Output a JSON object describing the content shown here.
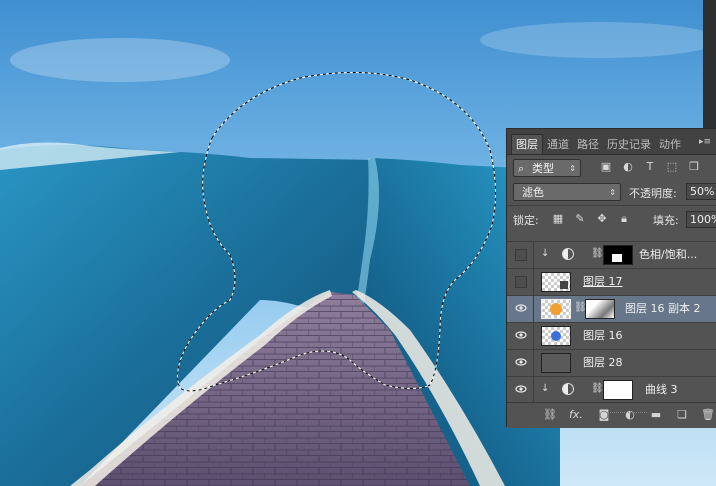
{
  "panel": {
    "tabs": [
      "图层",
      "通道",
      "路径",
      "历史记录",
      "动作"
    ],
    "active_tab": "图层",
    "filter": {
      "label": "类型"
    },
    "blend_mode": "滤色",
    "opacity_label": "不透明度:",
    "opacity_value": "50%",
    "lock_label": "锁定:",
    "fill_label": "填充:",
    "fill_value": "100%",
    "layers": [
      {
        "name": "色相/饱和...",
        "visible": false,
        "type": "adjustment"
      },
      {
        "name": "图层 17",
        "visible": false,
        "type": "pixel"
      },
      {
        "name": "图层 16 副本 2",
        "visible": true,
        "type": "masked",
        "selected": true
      },
      {
        "name": "图层 16",
        "visible": true,
        "type": "pixel"
      },
      {
        "name": "图层 28",
        "visible": true,
        "type": "pixel"
      },
      {
        "name": "曲线 3",
        "visible": true,
        "type": "adjustment"
      }
    ]
  },
  "colors": {
    "panel_bg": "#535353",
    "selection": "#677689",
    "sky": "#5aa6dd",
    "wave": "#1f7fa8"
  }
}
